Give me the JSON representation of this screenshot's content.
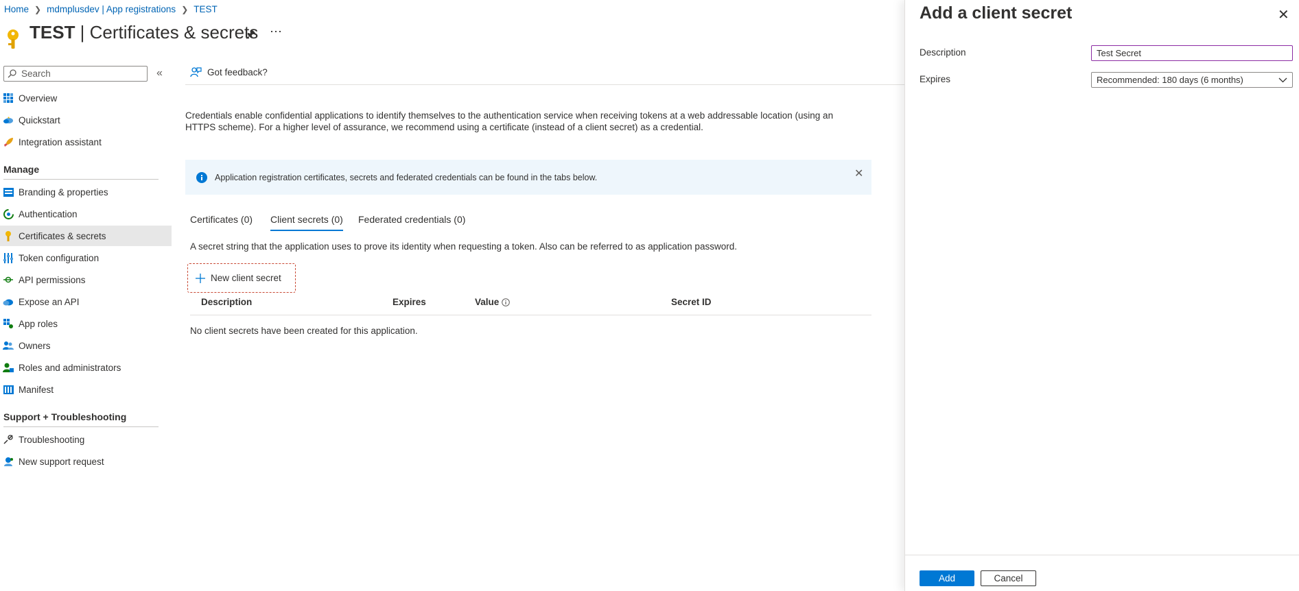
{
  "breadcrumb": {
    "items": [
      "Home",
      "mdmplusdev | App registrations",
      "TEST"
    ]
  },
  "header": {
    "app_name": "TEST",
    "title": "Certificates & secrets"
  },
  "sidebar": {
    "search_placeholder": "Search",
    "items_top": [
      {
        "label": "Overview",
        "icon": "overview-icon"
      },
      {
        "label": "Quickstart",
        "icon": "quickstart-icon"
      },
      {
        "label": "Integration assistant",
        "icon": "rocket-icon"
      }
    ],
    "manage_heading": "Manage",
    "manage_items": [
      {
        "label": "Branding & properties",
        "icon": "branding-icon"
      },
      {
        "label": "Authentication",
        "icon": "authentication-icon"
      },
      {
        "label": "Certificates & secrets",
        "icon": "key-icon",
        "active": true
      },
      {
        "label": "Token configuration",
        "icon": "token-icon"
      },
      {
        "label": "API permissions",
        "icon": "api-permissions-icon"
      },
      {
        "label": "Expose an API",
        "icon": "cloud-icon"
      },
      {
        "label": "App roles",
        "icon": "app-roles-icon"
      },
      {
        "label": "Owners",
        "icon": "owners-icon"
      },
      {
        "label": "Roles and administrators",
        "icon": "roles-icon"
      },
      {
        "label": "Manifest",
        "icon": "manifest-icon"
      }
    ],
    "support_heading": "Support + Troubleshooting",
    "support_items": [
      {
        "label": "Troubleshooting",
        "icon": "wrench-icon"
      },
      {
        "label": "New support request",
        "icon": "support-icon"
      }
    ]
  },
  "toolbar": {
    "feedback_label": "Got feedback?"
  },
  "main": {
    "description": "Credentials enable confidential applications to identify themselves to the authentication service when receiving tokens at a web addressable location (using an HTTPS scheme). For a higher level of assurance, we recommend using a certificate (instead of a client secret) as a credential.",
    "info_message": "Application registration certificates, secrets and federated credentials can be found in the tabs below.",
    "tabs": [
      {
        "label": "Certificates (0)"
      },
      {
        "label": "Client secrets (0)",
        "active": true
      },
      {
        "label": "Federated credentials (0)"
      }
    ],
    "secret_description": "A secret string that the application uses to prove its identity when requesting a token. Also can be referred to as application password.",
    "new_secret_label": "New client secret",
    "table": {
      "columns": [
        "Description",
        "Expires",
        "Value",
        "Secret ID"
      ],
      "empty_message": "No client secrets have been created for this application."
    }
  },
  "panel": {
    "title": "Add a client secret",
    "description_label": "Description",
    "description_value": "Test Secret",
    "expires_label": "Expires",
    "expires_value": "Recommended: 180 days (6 months)",
    "add_label": "Add",
    "cancel_label": "Cancel"
  },
  "colors": {
    "accent": "#0078d4",
    "link": "#0064b4",
    "info_bg": "#eef6fc",
    "highlight_border": "#c84833",
    "input_focus": "#8b2ba3"
  }
}
